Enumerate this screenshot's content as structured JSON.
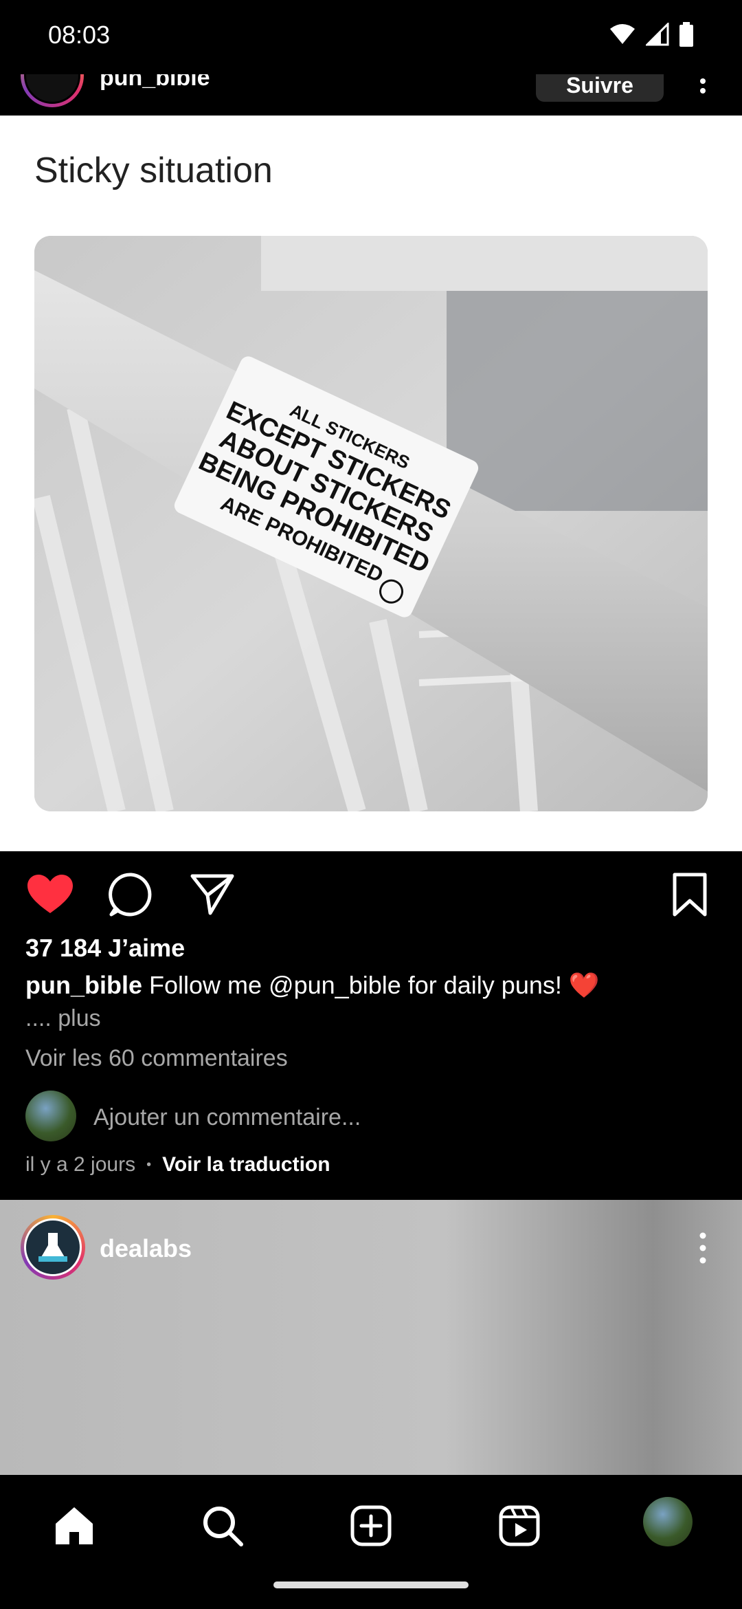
{
  "status_bar": {
    "time": "08:03",
    "icons": [
      "wifi-icon",
      "signal-icon",
      "battery-icon"
    ]
  },
  "top_post": {
    "username": "pun_bible",
    "follow_label": "Suivre"
  },
  "post": {
    "title": "Sticky situation",
    "image_sticker_lines": [
      "ALL STICKERS",
      "EXCEPT STICKERS",
      "ABOUT STICKERS",
      "BEING PROHIBITED",
      "ARE PROHIBITED"
    ],
    "likes": "37 184 J’aime",
    "caption_user": "pun_bible",
    "caption_text": "Follow me @pun_bible for daily puns! ❤️",
    "more_label": ".... plus",
    "view_comments": "Voir les 60 commentaires",
    "comment_placeholder": "Ajouter un commentaire...",
    "time_ago": "il y a 2 jours",
    "translate_label": "Voir la traduction"
  },
  "next_post": {
    "username": "dealabs"
  },
  "bottom_nav": {
    "items": [
      "home-icon",
      "search-icon",
      "create-icon",
      "reels-icon",
      "profile-avatar"
    ]
  },
  "colors": {
    "like_red": "#ff3040",
    "background": "#000000",
    "secondary_text": "#a8a8a8"
  }
}
